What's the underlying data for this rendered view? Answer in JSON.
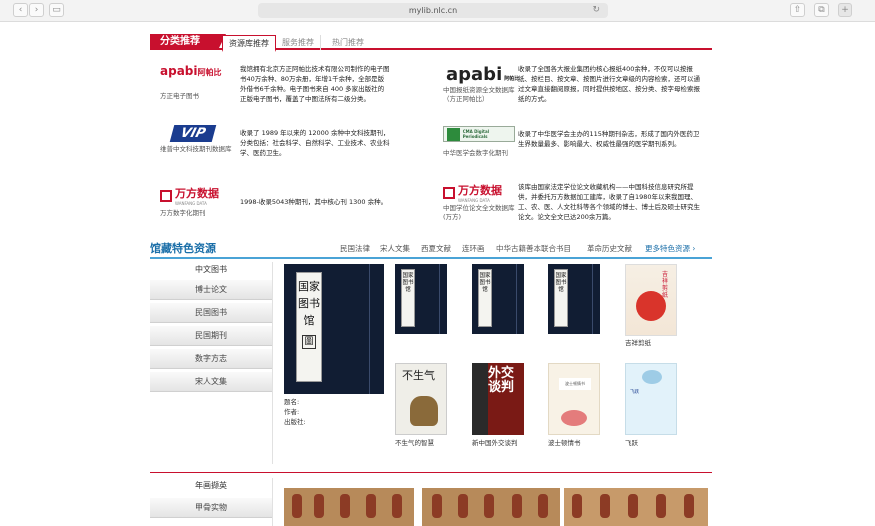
{
  "browser": {
    "url": "mylib.nlc.cn",
    "back_icon": "chevron-left-icon",
    "forward_icon": "chevron-right-icon"
  },
  "top_panel": {
    "badge": "分类推荐",
    "tabs": [
      "资源库推荐",
      "服务推荐",
      "热门推荐"
    ],
    "databases": [
      {
        "logo": "apabi",
        "logo_sub": "阿帕比",
        "name": "方正电子图书",
        "desc": "我馆拥有北京方正阿帕比技术有限公司制作的电子图书40万余种、80万余册，年增1千余种，全部是版外借书6千余种。电子图书来自 400 多家出版社的正版电子图书，覆盖了中图法所有二级分类。"
      },
      {
        "logo": "apabi",
        "logo_sub": "阿帕比",
        "name": "中国报纸资源全文数据库（方正阿帕比）",
        "desc": "收录了全国各大报业集团约核心报纸400余种，不仅可以按报纸、按栏目、按文章、按图片进行文章级的内容检索，还可以通过文章直接翻阅原报，同时提供按地区、按分类、按字母检索报纸的方式。"
      },
      {
        "logo": "VIP",
        "name": "维普中文科技期刊数据库",
        "desc": "收录了 1989 年以来的 12000 余种中文科技期刊，分类包括：社会科学、自然科学、工业技术、农业科学、医药卫生。"
      },
      {
        "logo": "CMA Digital Periodicals",
        "name": "中华医学会数字化期刊",
        "desc": "收录了中华医学会主办的115种期刊杂志，形成了国内外医药卫生界数量最多、影响最大、权威性最强的医学期刊系列。"
      },
      {
        "logo": "万方数据",
        "logo_sub": "WANFANG DATA",
        "name": "万方数字化期刊",
        "desc": "1998-收录5043种期刊，其中核心刊 1300 余种。"
      },
      {
        "logo": "万方数据",
        "logo_sub": "WANFANG DATA",
        "name": "中国学位论文全文数据库(万方)",
        "desc": "该库由国家法定学位论文收藏机构——中国科技信息研究所提供，并委托万方数据加工建库，收录了自1980年以来我国理、工、农、医、人文社科等各个领域的博士、博士后及硕士研究生论文。论文全文已达200余万篇。"
      }
    ]
  },
  "special": {
    "title": "馆藏特色资源",
    "links": [
      "民国法律",
      "宋人文集",
      "西夏文献",
      "连环画",
      "中华古籍善本联合书目",
      "革命历史文献"
    ],
    "more": "更多特色资源 ›",
    "side_head": "中文图书",
    "side_items": [
      "博士论文",
      "民国图书",
      "民国期刊",
      "数字方志",
      "宋人文集"
    ],
    "big_book_label": "国家图书馆",
    "big_book_seal": "圖",
    "meta": [
      "题名:",
      "作者:",
      "出版社:"
    ],
    "small_book_label": "国家图书馆",
    "covers": [
      {
        "caption": "吉祥剪纸",
        "title": "吉祥剪纸"
      },
      {
        "caption": "不生气的智慧",
        "title": "不生气"
      },
      {
        "caption": "新中国外交谈判",
        "title": "外交谈判"
      },
      {
        "caption": "波士顿情书",
        "title": "波士顿情书"
      },
      {
        "caption": "飞跃",
        "title": "飞跃"
      }
    ]
  },
  "bottom": {
    "head": "年画撷英",
    "side_items": [
      "甲骨实物"
    ]
  }
}
